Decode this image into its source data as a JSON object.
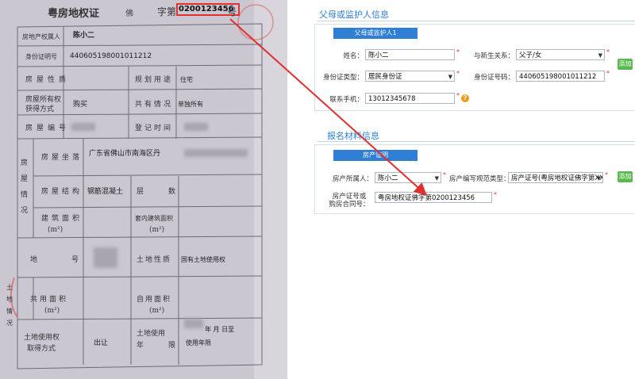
{
  "certificate": {
    "title": "粤房地权证",
    "city_char": "佛",
    "zi_char": "字第",
    "number": "0200123456",
    "hao_char": "号",
    "rows": {
      "owner_label": "房地产权属人",
      "owner_value": "陈小二",
      "id_label": "身份证明号",
      "id_value": "440605198001011212",
      "nature_label": "房屋性质",
      "use_label": "规划用途",
      "use_value": "住宅",
      "acq_label1": "房屋所有权",
      "acq_label2": "获得方式",
      "acq_value": "购买",
      "share_label": "共有情况",
      "share_value": "单独所有",
      "house_no_label": "房屋编号",
      "reg_time_label": "登记时间",
      "side_house_label": "房屋情况",
      "location_label": "房屋坐落",
      "location_value": "广东省佛山市南海区丹",
      "structure_label": "房屋结构",
      "structure_value": "钢筋混凝土",
      "floors_label": "层",
      "floors_label2": "数",
      "area_label": "建筑面积",
      "area_unit": "(m²)",
      "inner_area_label": "套内建筑面积",
      "inner_area_unit": "(m²)",
      "lot_label": "地",
      "lot_label2": "号",
      "land_nature_label": "土地性质",
      "land_nature_value": "国有土地使用权",
      "side_land_label": "土地情况",
      "shared_area_label": "共用面积",
      "shared_area_unit": "(m²)",
      "own_area_label": "自用面积",
      "own_area_unit": "(m²)",
      "land_acq_label1": "土地使用权",
      "land_acq_label2": "取得方式",
      "land_acq_value": "出让",
      "land_term_label1": "土地使用",
      "land_term_label2": "年",
      "land_term_label3": "限",
      "land_term_value1": "年 月 日至",
      "land_term_value2": "使用年限"
    }
  },
  "form": {
    "guardian_section": "父母或监护人信息",
    "guardian_tab": "父母或监护人1",
    "name_label": "姓名：",
    "name_value": "陈小二",
    "relation_label": "与新生关系：",
    "relation_value": "父子/女",
    "add_label": "添加",
    "id_type_label": "身份证类型：",
    "id_type_value": "居民身份证",
    "id_no_label": "身份证号码：",
    "id_no_value": "440605198001011212",
    "phone_label": "联系手机：",
    "phone_value": "13012345678",
    "materials_section": "报名材料信息",
    "property_tab": "房产证明",
    "owner_label": "房产所属人：",
    "owner_value": "陈小二",
    "cert_type_label": "房产编写规范类型：",
    "cert_type_value": "房产证号(粤房地权证佛字第XXX",
    "add2_label": "添加",
    "cert_no_label1": "房产证号或",
    "cert_no_label2": "购房合同号：",
    "cert_no_value": "粤房地权证佛字第0200123456"
  },
  "colors": {
    "accent": "#2f7fd4",
    "add": "#59b84e",
    "required": "#e03030",
    "arrow": "#e03030"
  }
}
